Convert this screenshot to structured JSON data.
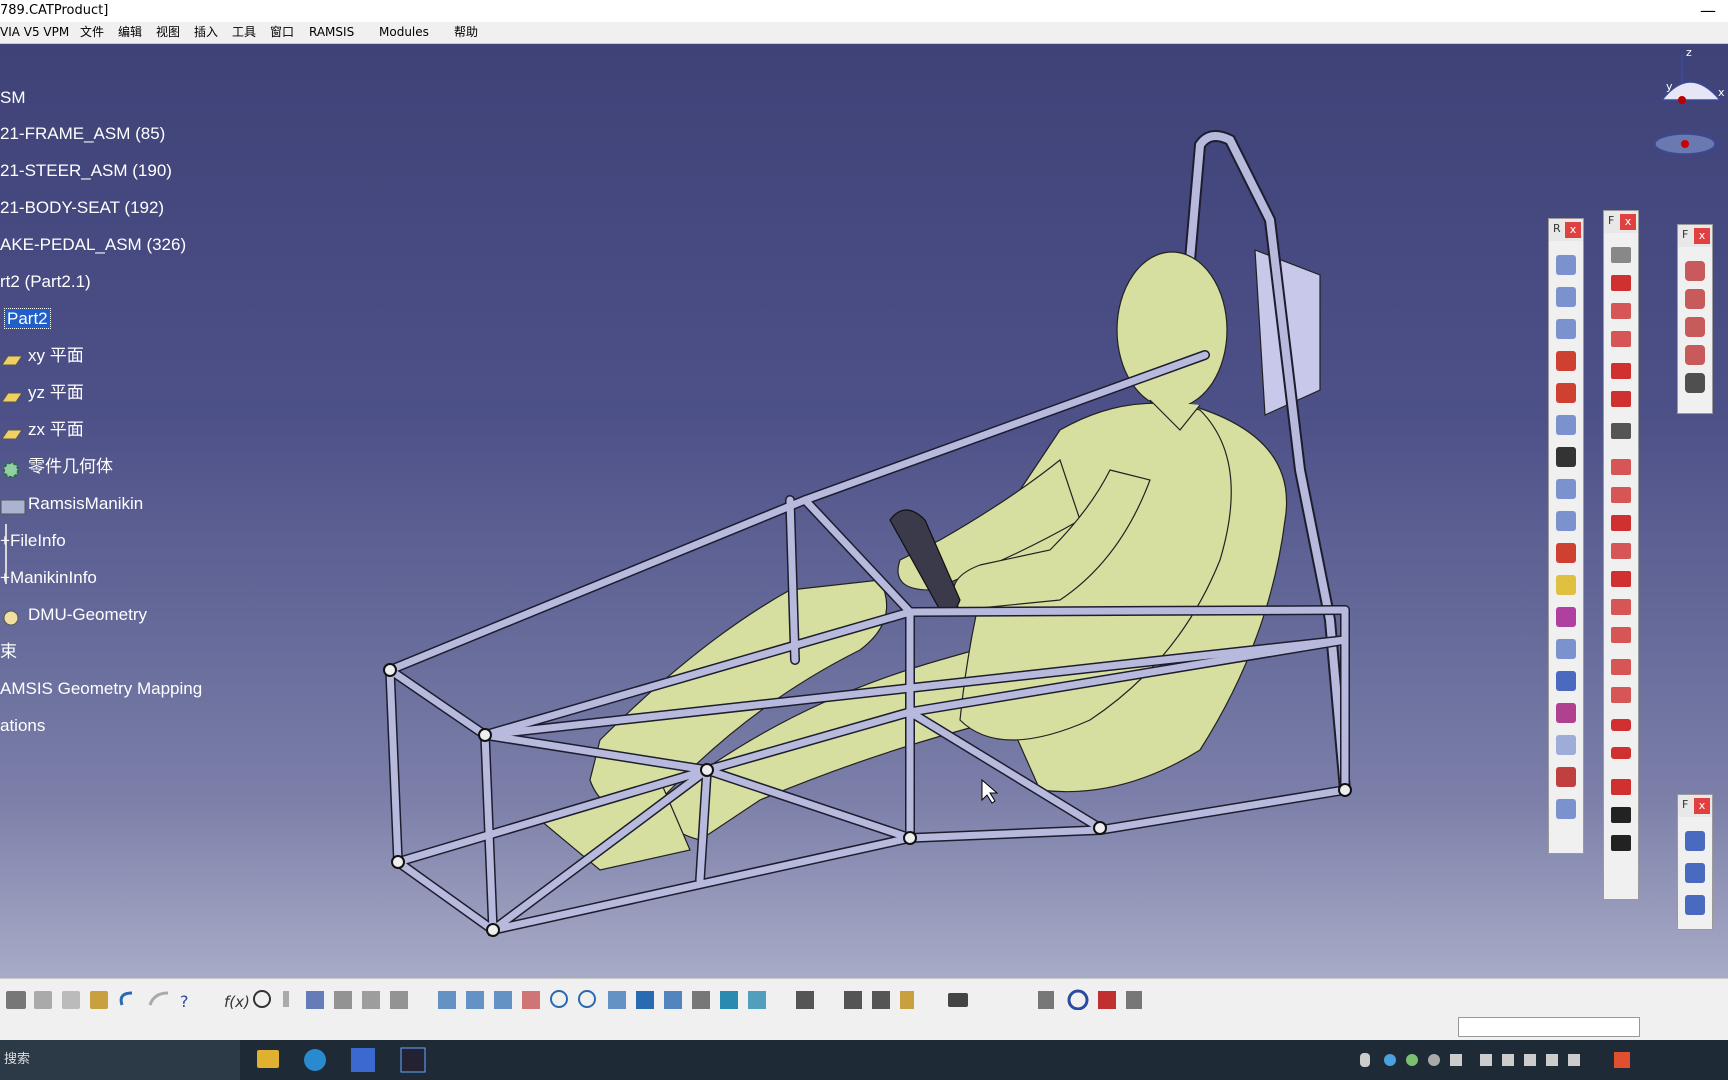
{
  "window": {
    "title": "789.CATProduct]",
    "close_glyph": "—"
  },
  "menu": {
    "items": [
      "VIA V5 VPM",
      "文件",
      "编辑",
      "视图",
      "插入",
      "工具",
      "窗口",
      "RAMSIS",
      "Modules",
      "帮助"
    ]
  },
  "tree": {
    "nodes": [
      "SM",
      "21-FRAME_ASM (85)",
      "21-STEER_ASM (190)",
      "21-BODY-SEAT (192)",
      "AKE-PEDAL_ASM (326)",
      "rt2 (Part2.1)",
      "Part2",
      "xy 平面",
      "yz 平面",
      "zx 平面",
      "零件几何体",
      "RamsisManikin",
      "FileInfo",
      "ManikinInfo",
      "DMU-Geometry",
      "束",
      "AMSIS Geometry Mapping",
      "ations"
    ]
  },
  "compass": {
    "axis_z": "z",
    "axis_y": "y",
    "axis_x": "x"
  },
  "palettes": {
    "p1": {
      "label": "R",
      "close": "x"
    },
    "p2": {
      "label": "F",
      "close": "x"
    },
    "p3": {
      "label": "F",
      "close": "x"
    },
    "p4": {
      "label": "F",
      "close": "x"
    }
  },
  "toolbar": {
    "icons": [
      "print-icon",
      "cut-icon",
      "copy-icon",
      "paste-icon",
      "undo-icon",
      "redo-icon",
      "whats-this-icon",
      "formula-icon",
      "comment-icon",
      "knowledge-icon",
      "table-icon",
      "tree-icon",
      "catalog-icon",
      "params-icon",
      "fly-icon",
      "fit-all-icon",
      "pan-icon",
      "rotate-icon",
      "zoom-in-icon",
      "zoom-out-icon",
      "normal-view-icon",
      "multi-view-icon",
      "iso-view-icon",
      "render-style-icon",
      "hide-show-icon",
      "swap-space-icon",
      "analysis-icon",
      "measure-icon",
      "catalog2-icon",
      "inertia-icon",
      "camera-icon",
      "doc-icon",
      "refresh-icon",
      "delete-icon",
      "clipboard-icon"
    ]
  },
  "taskbar": {
    "search_text": "搜索"
  },
  "colors": {
    "viewport_top": "#3f4277",
    "viewport_bottom": "#a8abc6",
    "manikin": "#d6dfa0",
    "frame": "#b7b9dd"
  }
}
